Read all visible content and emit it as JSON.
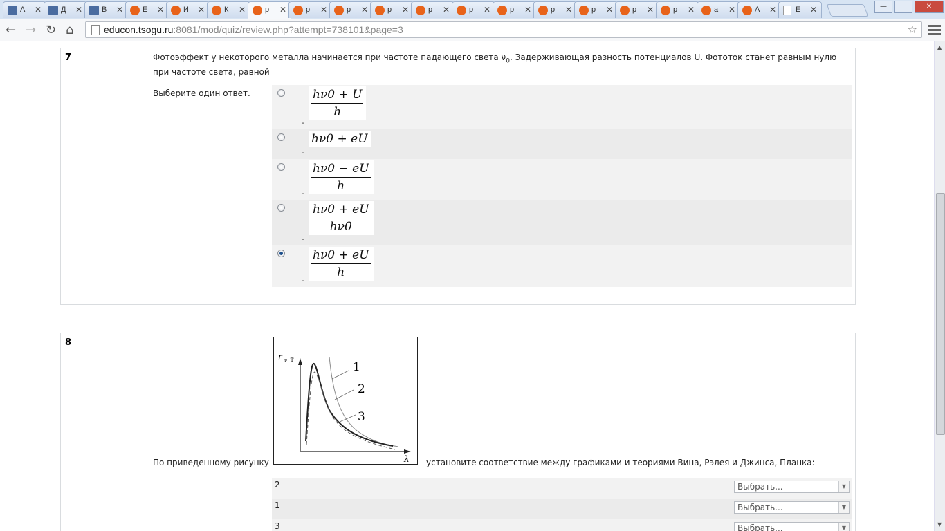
{
  "browser": {
    "tabs": [
      {
        "label": "А"
      },
      {
        "label": "Д"
      },
      {
        "label": "В"
      },
      {
        "label": "Е"
      },
      {
        "label": "И"
      },
      {
        "label": "К"
      },
      {
        "label": "р"
      },
      {
        "label": "р"
      },
      {
        "label": "р"
      },
      {
        "label": "р"
      },
      {
        "label": "р"
      },
      {
        "label": "р"
      },
      {
        "label": "р"
      },
      {
        "label": "р"
      },
      {
        "label": "р"
      },
      {
        "label": "р"
      },
      {
        "label": "р"
      },
      {
        "label": "а"
      },
      {
        "label": "А"
      },
      {
        "label": "Е"
      }
    ],
    "active_tab_index": 6,
    "url_host": "educon.tsogu.ru",
    "url_rest": ":8081/mod/quiz/review.php?attempt=738101&page=3"
  },
  "q7": {
    "number": "7",
    "text": "Фотоэффект у некоторого металла начинается при частоте падающего света ν",
    "text_sub": "0",
    "text_tail": ". Задерживающая разность потенциалов U. Фототок станет равным нулю при частоте света, равной",
    "prompt": "Выберите один ответ.",
    "answers": [
      {
        "num": "hν0 + U",
        "den": "h",
        "checked": false
      },
      {
        "num": "hν0 + eU",
        "den": "",
        "checked": false
      },
      {
        "num": "hν0 − eU",
        "den": "h",
        "checked": false
      },
      {
        "num": "hν0 + eU",
        "den": "hν0",
        "checked": false
      },
      {
        "num": "hν0 + eU",
        "den": "h",
        "checked": true
      }
    ]
  },
  "q8": {
    "number": "8",
    "text_before": "По приведенному рисунку",
    "text_after": "установите соответствие между графиками и теориями Вина, Рэлея и Джинса, Планка:",
    "figure": {
      "ylabel": "r",
      "ylabel_sub": "ν, T",
      "xlabel": "λ",
      "curve_labels": [
        "1",
        "2",
        "3"
      ]
    },
    "rows": [
      {
        "label": "2",
        "select": "Выбрать..."
      },
      {
        "label": "1",
        "select": "Выбрать..."
      },
      {
        "label": "3",
        "select": "Выбрать..."
      }
    ]
  }
}
